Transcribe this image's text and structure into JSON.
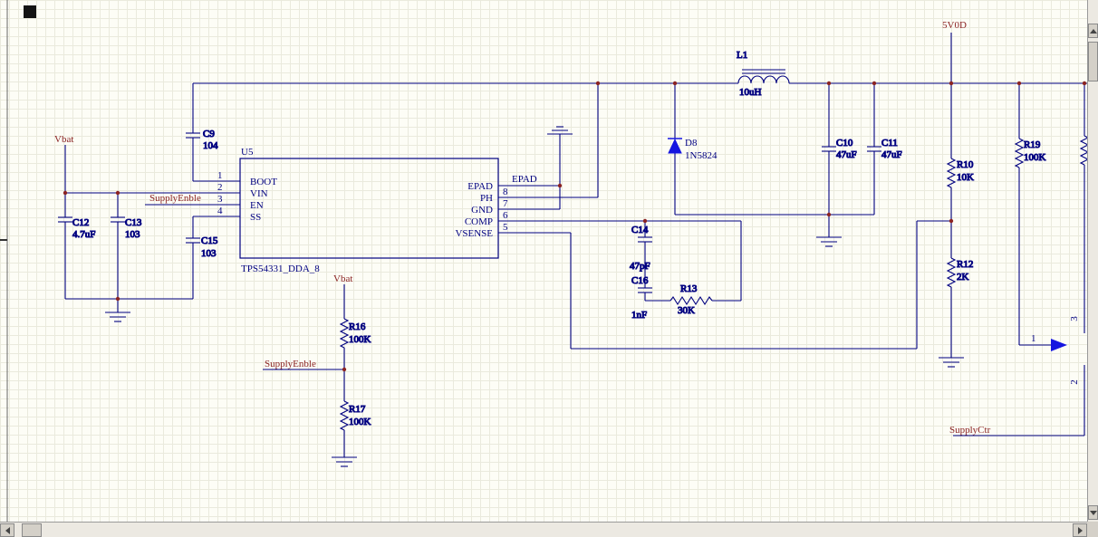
{
  "colors": {
    "wire": "#000080",
    "junction": "#8b2323",
    "net_label": "#8b2323",
    "component_text": "#000080",
    "diode_fill": "#1515e0",
    "grid": "#eaeadd",
    "canvas_bg": "#fdfdf6",
    "scrollbar_face": "#d4d0c8"
  },
  "canvas": {
    "nets": {
      "vbat_left": "Vbat",
      "supply_enble_en": "SupplyEnble",
      "vbat_divider": "Vbat",
      "supply_enble_divider": "SupplyEnble",
      "v5": "5V0D",
      "supply_ctr": "SupplyCtr",
      "epad": "EPAD"
    },
    "ic": {
      "designator": "U5",
      "part": "TPS54331_DDA_8",
      "pins_left": [
        {
          "num": "1",
          "name": "BOOT"
        },
        {
          "num": "2",
          "name": "VIN"
        },
        {
          "num": "3",
          "name": "EN"
        },
        {
          "num": "4",
          "name": "SS"
        }
      ],
      "pins_right": [
        {
          "num": "",
          "name": "EPAD"
        },
        {
          "num": "8",
          "name": "PH"
        },
        {
          "num": "7",
          "name": "GND"
        },
        {
          "num": "6",
          "name": "COMP"
        },
        {
          "num": "5",
          "name": "VSENSE"
        }
      ]
    },
    "components": {
      "c9": {
        "ref": "C9",
        "value": "104"
      },
      "c12": {
        "ref": "C12",
        "value": "4.7uF"
      },
      "c13": {
        "ref": "C13",
        "value": "103"
      },
      "c15": {
        "ref": "C15",
        "value": "103"
      },
      "l1": {
        "ref": "L1",
        "value": "10uH"
      },
      "d8": {
        "ref": "D8",
        "value": "1N5824"
      },
      "c10": {
        "ref": "C10",
        "value": "47uF"
      },
      "c11": {
        "ref": "C11",
        "value": "47uF"
      },
      "c14": {
        "ref": "C14",
        "value": "47pF"
      },
      "c16": {
        "ref": "C16",
        "value": "1nF"
      },
      "r13": {
        "ref": "R13",
        "value": "30K"
      },
      "r10": {
        "ref": "R10",
        "value": "10K"
      },
      "r12": {
        "ref": "R12",
        "value": "2K"
      },
      "r19": {
        "ref": "R19",
        "value": "100K"
      },
      "r16": {
        "ref": "R16",
        "value": "100K"
      },
      "r17": {
        "ref": "R17",
        "value": "100K"
      }
    },
    "connector": {
      "pin1": "1",
      "pin2": "2",
      "pin3": "3"
    }
  }
}
